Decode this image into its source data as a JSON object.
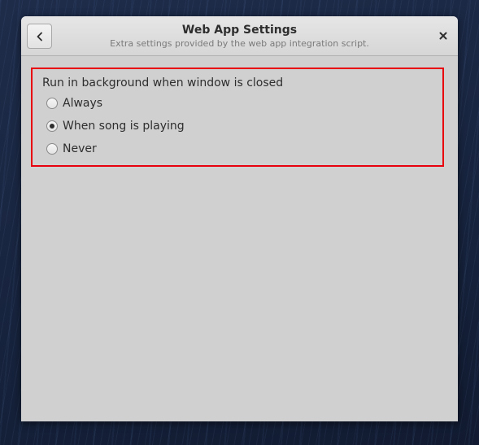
{
  "window": {
    "title": "Web App Settings",
    "subtitle": "Extra settings provided by the web app integration script."
  },
  "icons": {
    "back": "chevron-left-icon",
    "close": "close-icon"
  },
  "settings": {
    "group_label": "Run in background when window is closed",
    "options": [
      {
        "label": "Always",
        "selected": false
      },
      {
        "label": "When song is playing",
        "selected": true
      },
      {
        "label": "Never",
        "selected": false
      }
    ]
  },
  "colors": {
    "highlight_border": "#e8000d",
    "window_background": "#d0d0d0"
  }
}
